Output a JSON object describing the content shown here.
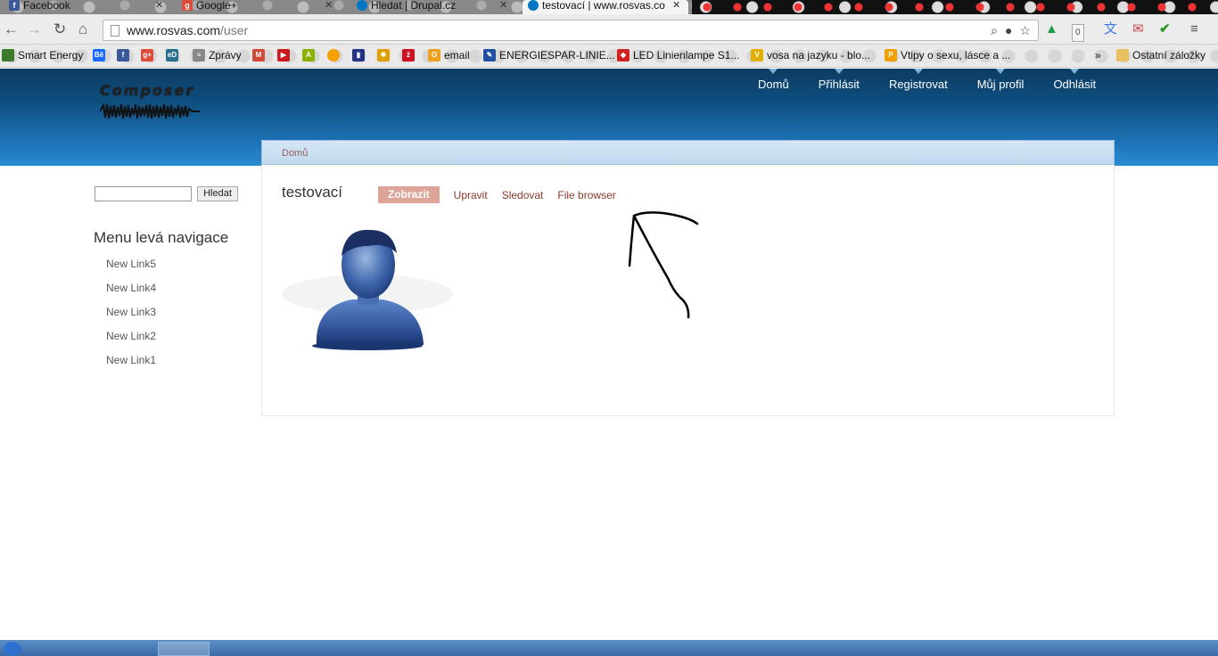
{
  "browser": {
    "tabs": [
      {
        "title": "Facebook",
        "favicon": "facebook-icon",
        "color": "#3b5998",
        "glyph": "f"
      },
      {
        "title": "Google+",
        "favicon": "google-plus-icon",
        "color": "#dd4b39",
        "glyph": "g+"
      },
      {
        "title": "Hledat | Drupal.cz",
        "favicon": "drupal-icon",
        "color": "#0077c0",
        "glyph": "d"
      },
      {
        "title": "testovací | www.rosvas.co",
        "favicon": "drupal-icon",
        "color": "#0077c0",
        "glyph": "d"
      }
    ],
    "url_host": "www.rosvas.com",
    "url_path": "/user",
    "extension_badge": "0",
    "bookmarks": [
      {
        "label": "Smart Energy",
        "icon": "smart-energy-icon",
        "color": "#3a7a2a"
      },
      {
        "label": "",
        "icon": "be-icon",
        "color": "#1769ff"
      },
      {
        "label": "",
        "icon": "facebook-icon",
        "color": "#3b5998"
      },
      {
        "label": "",
        "icon": "google-plus-icon",
        "color": "#dd4b39"
      },
      {
        "label": "",
        "icon": "ed-icon",
        "color": "#2a6f8f"
      },
      {
        "label": "Zprávy",
        "icon": "news-icon",
        "color": "#888888"
      },
      {
        "label": "",
        "icon": "gmail-icon",
        "color": "#d14836"
      },
      {
        "label": "",
        "icon": "youtube-icon",
        "color": "#cc181e"
      },
      {
        "label": "",
        "icon": "android-icon",
        "color": "#8ab000"
      },
      {
        "label": "",
        "icon": "orange-circle-icon",
        "color": "#f5a000"
      },
      {
        "label": "",
        "icon": "tag-icon",
        "color": "#223388"
      },
      {
        "label": "",
        "icon": "star-badge-icon",
        "color": "#e0a000"
      },
      {
        "label": "",
        "icon": "zive-icon",
        "color": "#d01020"
      },
      {
        "label": "email",
        "icon": "email-icon",
        "color": "#f0a020"
      },
      {
        "label": "ENERGIESPAR-LINIE...",
        "icon": "energiespar-icon",
        "color": "#2050a0"
      },
      {
        "label": "LED Linienlampe S1...",
        "icon": "led-icon",
        "color": "#d02020"
      },
      {
        "label": "vosa na jazyku - blo...",
        "icon": "vosa-icon",
        "color": "#e0b000"
      },
      {
        "label": "Vtipy o sexu, lásce a ...",
        "icon": "vtipy-icon",
        "color": "#f0a000"
      }
    ],
    "bookmarks_overflow": "»",
    "other_bookmarks": "Ostatní záložky"
  },
  "site": {
    "logo_text": "Composer",
    "nav": [
      "Domů",
      "Přihlásit",
      "Registrovat",
      "Můj profil",
      "Odhlásit"
    ],
    "breadcrumb": "Domů",
    "page_title": "testovací",
    "tabs": [
      "Zobrazit",
      "Upravit",
      "Sledovat",
      "File browser"
    ],
    "active_tab": "Zobrazit",
    "search_button": "Hledat",
    "sidebar_title": "Menu levá navigace",
    "sidebar_links": [
      "New Link5",
      "New Link4",
      "New Link3",
      "New Link2",
      "New Link1"
    ]
  },
  "colors": {
    "header_dark": "#0b3c62",
    "header_light": "#2a8bd1",
    "tab_active_bg": "#dea49a",
    "link": "#8a3a2e"
  }
}
